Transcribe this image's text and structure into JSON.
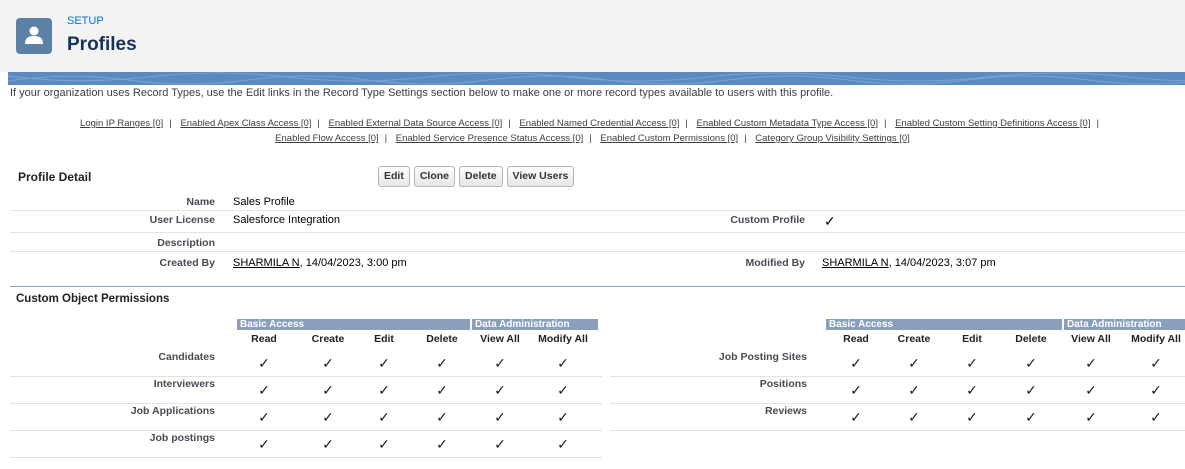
{
  "header": {
    "setup_label": "SETUP",
    "title": "Profiles",
    "icon": "user-icon"
  },
  "info_text": "If your organization uses Record Types, use the Edit links in the Record Type Settings section below to make one or more record types available to users with this profile.",
  "links_row1": [
    "Login IP Ranges [0]",
    "Enabled Apex Class Access [0]",
    "Enabled External Data Source Access [0]",
    "Enabled Named Credential Access [0]",
    "Enabled Custom Metadata Type Access [0]",
    "Enabled Custom Setting Definitions Access [0]"
  ],
  "links_row2": [
    "Enabled Flow Access [0]",
    "Enabled Service Presence Status Access [0]",
    "Enabled Custom Permissions [0]",
    "Category Group Visibility Settings [0]"
  ],
  "profile_detail": {
    "title": "Profile Detail",
    "buttons": {
      "edit": "Edit",
      "clone": "Clone",
      "delete": "Delete",
      "view_users": "View Users"
    },
    "name_label": "Name",
    "name_value": "Sales Profile",
    "license_label": "User License",
    "license_value": "Salesforce Integration",
    "custom_label": "Custom Profile",
    "custom_value": "✓",
    "description_label": "Description",
    "created_label": "Created By",
    "created_user": "SHARMILA N",
    "created_date": ", 14/04/2023, 3:00 pm",
    "modified_label": "Modified By",
    "modified_user": "SHARMILA N",
    "modified_date": ", 14/04/2023, 3:07 pm"
  },
  "cop": {
    "title": "Custom Object Permissions",
    "group_basic": "Basic Access",
    "group_admin": "Data Administration",
    "columns": [
      "Read",
      "Create",
      "Edit",
      "Delete",
      "View All",
      "Modify All"
    ],
    "check": "✓",
    "left_rows": [
      "Candidates",
      "Interviewers",
      "Job Applications",
      "Job postings"
    ],
    "right_rows": [
      "Job Posting Sites",
      "Positions",
      "Reviews"
    ]
  }
}
